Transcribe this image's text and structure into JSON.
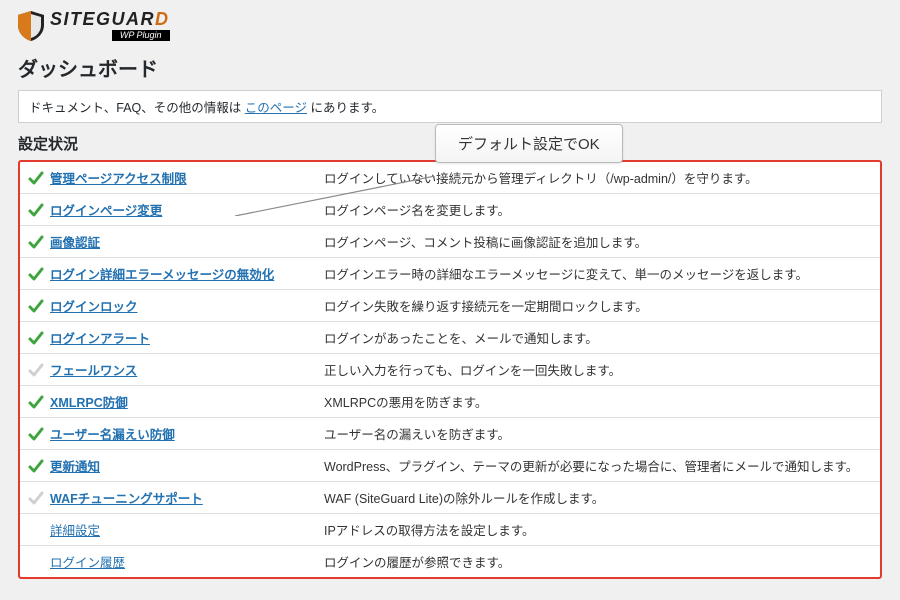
{
  "brand": {
    "part1": "SITEGUAR",
    "part2": "D",
    "sub": "WP Plugin"
  },
  "dashboard_title": "ダッシュボード",
  "info_prefix": "ドキュメント、FAQ、その他の情報は ",
  "info_link": "このページ",
  "info_suffix": " にあります。",
  "section_title": "設定状況",
  "callout": "デフォルト設定でOK",
  "rows": [
    {
      "enabled": true,
      "label": "管理ページアクセス制限",
      "desc": "ログインしていない接続元から管理ディレクトリ（/wp-admin/）を守ります。"
    },
    {
      "enabled": true,
      "label": "ログインページ変更",
      "desc": "ログインページ名を変更します。"
    },
    {
      "enabled": true,
      "label": "画像認証",
      "desc": "ログインページ、コメント投稿に画像認証を追加します。"
    },
    {
      "enabled": true,
      "label": "ログイン詳細エラーメッセージの無効化",
      "desc": "ログインエラー時の詳細なエラーメッセージに変えて、単一のメッセージを返します。"
    },
    {
      "enabled": true,
      "label": "ログインロック",
      "desc": "ログイン失敗を繰り返す接続元を一定期間ロックします。"
    },
    {
      "enabled": true,
      "label": "ログインアラート",
      "desc": "ログインがあったことを、メールで通知します。"
    },
    {
      "enabled": false,
      "label": "フェールワンス",
      "desc": "正しい入力を行っても、ログインを一回失敗します。"
    },
    {
      "enabled": true,
      "label": "XMLRPC防御",
      "desc": "XMLRPCの悪用を防ぎます。"
    },
    {
      "enabled": true,
      "label": "ユーザー名漏えい防御",
      "desc": "ユーザー名の漏えいを防ぎます。"
    },
    {
      "enabled": true,
      "label": "更新通知",
      "desc": "WordPress、プラグイン、テーマの更新が必要になった場合に、管理者にメールで通知します。"
    },
    {
      "enabled": false,
      "label": "WAFチューニングサポート",
      "desc": "WAF (SiteGuard Lite)の除外ルールを作成します。"
    },
    {
      "enabled": null,
      "label": "詳細設定",
      "desc": "IPアドレスの取得方法を設定します。"
    },
    {
      "enabled": null,
      "label": "ログイン履歴",
      "desc": "ログインの履歴が参照できます。"
    }
  ]
}
